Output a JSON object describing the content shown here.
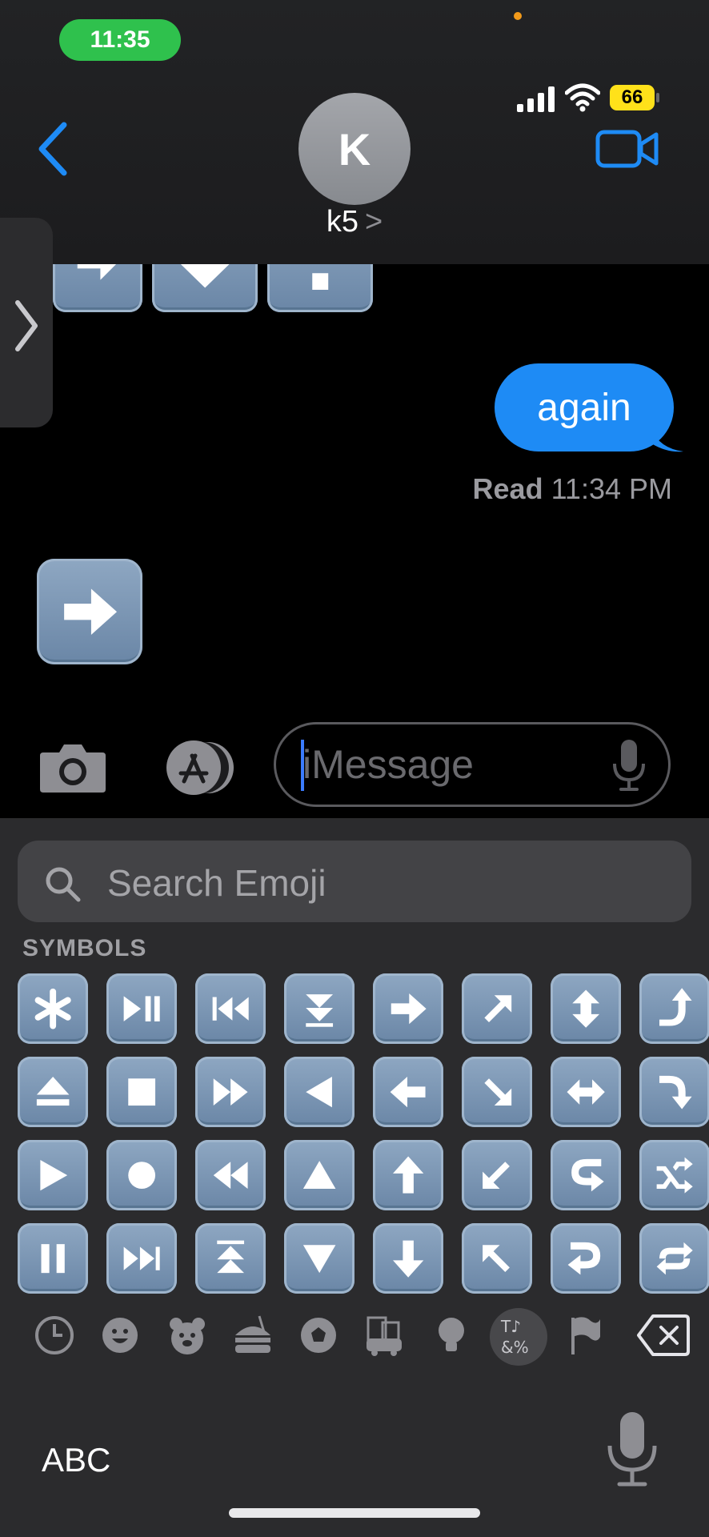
{
  "status_bar": {
    "time": "11:35",
    "battery": "66"
  },
  "header": {
    "avatar_initial": "K",
    "contact_name": "k5",
    "contact_chevron": ">"
  },
  "conversation": {
    "sent_message": "again",
    "read_receipt_label": "Read",
    "read_receipt_time": "11:34 PM",
    "received_emoji": "right-arrow"
  },
  "composer": {
    "placeholder": "iMessage"
  },
  "emoji_keyboard": {
    "search_placeholder": "Search Emoji",
    "section_label": "SYMBOLS",
    "rows": [
      [
        "asterisk",
        "play-pause",
        "previous-track",
        "fast-down",
        "right-arrow",
        "up-right-arrow",
        "up-down-arrow",
        "right-arrow-curving-up"
      ],
      [
        "eject",
        "stop",
        "fast-forward",
        "reverse",
        "left-arrow",
        "down-right-arrow",
        "left-right-arrow",
        "right-arrow-curving-down"
      ],
      [
        "play",
        "record",
        "fast-reverse",
        "upwards-button",
        "up-arrow",
        "down-left-arrow",
        "left-arrow-curving-right",
        "shuffle"
      ],
      [
        "pause",
        "next-track",
        "fast-up",
        "downwards-button",
        "down-arrow",
        "up-left-arrow",
        "right-arrow-curving-left",
        "repeat"
      ]
    ],
    "categories": [
      "recent",
      "smileys",
      "animals",
      "food",
      "activity",
      "travel",
      "objects",
      "symbols",
      "flags"
    ],
    "selected_category": "symbols",
    "abc_label": "ABC"
  }
}
